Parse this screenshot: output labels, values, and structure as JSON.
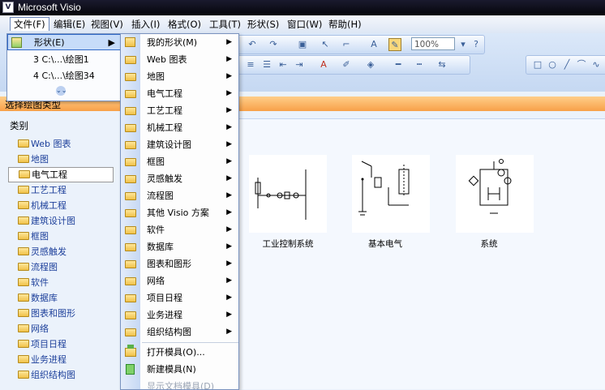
{
  "window": {
    "title": "Microsoft Visio"
  },
  "menubar": [
    {
      "label": "文件(F)",
      "active": true
    },
    {
      "label": "编辑(E)"
    },
    {
      "label": "视图(V)"
    },
    {
      "label": "插入(I)"
    },
    {
      "label": "格式(O)"
    },
    {
      "label": "工具(T)"
    },
    {
      "label": "形状(S)"
    },
    {
      "label": "窗口(W)"
    },
    {
      "label": "帮助(H)"
    }
  ],
  "toolbar": {
    "zoom": "100%"
  },
  "file_menu": {
    "shapes": "形状(E)",
    "recent1": "3 C:\\...\\绘图1",
    "recent2": "4 C:\\...\\绘图34"
  },
  "shapes_menu": {
    "items": [
      {
        "label": "我的形状(M)",
        "submenu": true
      },
      {
        "label": "Web 图表",
        "submenu": true
      },
      {
        "label": "地图",
        "submenu": true
      },
      {
        "label": "电气工程",
        "submenu": true
      },
      {
        "label": "工艺工程",
        "submenu": true
      },
      {
        "label": "机械工程",
        "submenu": true
      },
      {
        "label": "建筑设计图",
        "submenu": true
      },
      {
        "label": "框图",
        "submenu": true
      },
      {
        "label": "灵感触发",
        "submenu": true
      },
      {
        "label": "流程图",
        "submenu": true
      },
      {
        "label": "其他 Visio 方案",
        "submenu": true
      },
      {
        "label": "软件",
        "submenu": true
      },
      {
        "label": "数据库",
        "submenu": true
      },
      {
        "label": "图表和图形",
        "submenu": true
      },
      {
        "label": "网络",
        "submenu": true
      },
      {
        "label": "项目日程",
        "submenu": true
      },
      {
        "label": "业务进程",
        "submenu": true
      },
      {
        "label": "组织结构图",
        "submenu": true
      }
    ],
    "open_stencil": "打开模具(O)...",
    "new_stencil": "新建模具(N)",
    "show_doc_stencil": "显示文档模具(D)"
  },
  "task_pane": {
    "header": "选择绘图类型",
    "category_label": "类别",
    "categories": [
      "Web 图表",
      "地图",
      "电气工程",
      "工艺工程",
      "机械工程",
      "建筑设计图",
      "框图",
      "灵感触发",
      "流程图",
      "软件",
      "数据库",
      "图表和图形",
      "网络",
      "项目日程",
      "业务进程",
      "组织结构图"
    ],
    "selected": "电气工程"
  },
  "templates": [
    {
      "label": "工业控制系统"
    },
    {
      "label": "基本电气"
    },
    {
      "label": "系统"
    }
  ]
}
